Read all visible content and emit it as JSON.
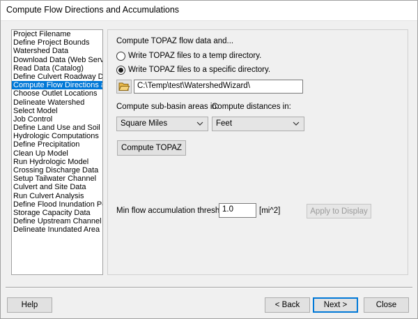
{
  "window": {
    "title": "Compute Flow Directions and Accumulations"
  },
  "steps": [
    "Project Filename",
    "Define Project Bounds",
    "Watershed Data",
    "Download Data (Web Service",
    "Read Data (Catalog)",
    "Define Culvert Roadway Data",
    "Compute Flow Directions and",
    "Choose Outlet Locations",
    "Delineate Watershed",
    "Select Model",
    "Job Control",
    "Define Land Use and Soil Dat",
    "Hydrologic Computations",
    "Define Precipitation",
    "Clean Up Model",
    "Run Hydrologic Model",
    "Crossing Discharge Data",
    "Setup Tailwater Channel",
    "Culvert and Site Data",
    "Run Culvert Analysis",
    "Define Flood Inundation Polyg",
    "Storage Capacity Data",
    "Define Upstream Channel",
    "Delineate Inundated Area"
  ],
  "selected_step": "Compute Flow Directions and",
  "panel": {
    "heading": "Compute TOPAZ flow data and...",
    "radio_temp": "Write TOPAZ files to a temp directory.",
    "radio_specific": "Write TOPAZ files to a specific directory.",
    "selected_radio": "specific",
    "directory_path": "C:\\Temp\\test\\WatershedWizard\\",
    "subbasin_label": "Compute sub-basin areas in:",
    "distance_label": "Compute distances in:",
    "subbasin_unit": "Square Miles",
    "distance_unit": "Feet",
    "compute_button": "Compute TOPAZ",
    "threshold_label": "Min flow accumulation threshold:",
    "threshold_value": "1.0",
    "threshold_unit": "[mi^2]",
    "apply_button": "Apply to Display"
  },
  "footer": {
    "help": "Help",
    "back": "< Back",
    "next": "Next >",
    "close": "Close"
  },
  "icons": {
    "folder": "folder-open-icon",
    "dropdown": "chevron-down-icon"
  },
  "colors": {
    "selection": "#0078d7",
    "default_button_border": "#0078d7",
    "folder": "#d9a520"
  }
}
